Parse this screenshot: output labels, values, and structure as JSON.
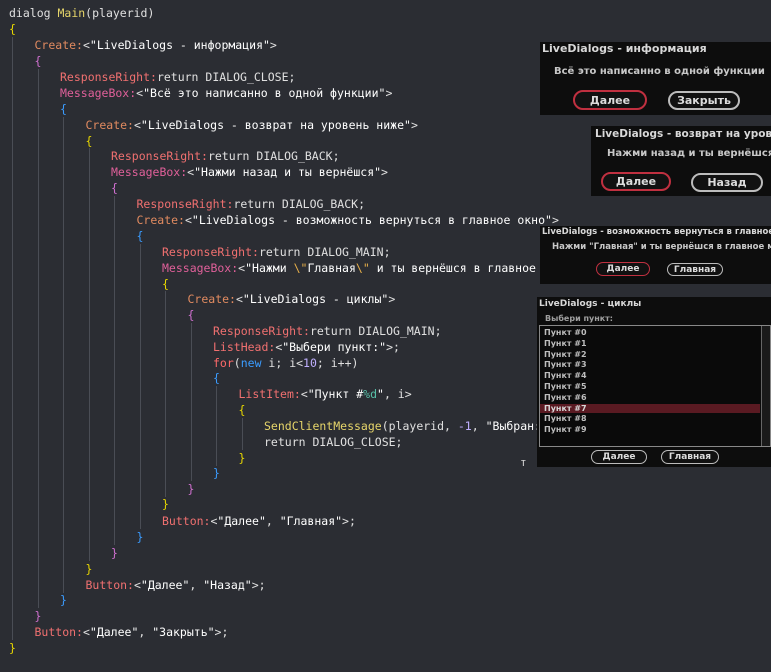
{
  "code_lines": [
    [
      [
        "dialog ",
        "op"
      ],
      [
        "Main",
        "fn"
      ],
      [
        "(playerid)",
        "op"
      ]
    ],
    [
      [
        "{",
        "b1"
      ]
    ],
    [
      [
        "Create:",
        "cr"
      ],
      [
        "<",
        "op"
      ],
      [
        "\"LiveDialogs - информация\"",
        "q"
      ],
      [
        ">",
        "op"
      ]
    ],
    [
      [
        "{",
        "b2"
      ]
    ],
    [
      [
        "ResponseRight:",
        "k"
      ],
      [
        "return ",
        "op"
      ],
      [
        "DIALOG_CLOSE;",
        "op"
      ]
    ],
    [
      [
        "MessageBox:",
        "mb"
      ],
      [
        "<",
        "op"
      ],
      [
        "\"Всё это написанно в одной функции\"",
        "q"
      ],
      [
        ">",
        "op"
      ]
    ],
    [
      [
        "{",
        "b3"
      ]
    ],
    [
      [
        "Create:",
        "cr"
      ],
      [
        "<",
        "op"
      ],
      [
        "\"LiveDialogs - возврат на уровень ниже\"",
        "q"
      ],
      [
        ">",
        "op"
      ]
    ],
    [
      [
        "{",
        "b1"
      ]
    ],
    [
      [
        "ResponseRight:",
        "k"
      ],
      [
        "return ",
        "op"
      ],
      [
        "DIALOG_BACK;",
        "op"
      ]
    ],
    [
      [
        "MessageBox:",
        "mb"
      ],
      [
        "<",
        "op"
      ],
      [
        "\"Нажми назад и ты вернёшся\"",
        "q"
      ],
      [
        ">",
        "op"
      ]
    ],
    [
      [
        "{",
        "b2"
      ]
    ],
    [
      [
        "ResponseRight:",
        "k"
      ],
      [
        "return ",
        "op"
      ],
      [
        "DIALOG_BACK;",
        "op"
      ]
    ],
    [
      [
        "Create:",
        "cr"
      ],
      [
        "<",
        "op"
      ],
      [
        "\"LiveDialogs - возможность вернуться в главное окно\"",
        "q"
      ],
      [
        ">",
        "op"
      ]
    ],
    [
      [
        "{",
        "b3"
      ]
    ],
    [
      [
        "ResponseRight:",
        "k"
      ],
      [
        "return ",
        "op"
      ],
      [
        "DIALOG_MAIN;",
        "op"
      ]
    ],
    [
      [
        "MessageBox:",
        "mb"
      ],
      [
        "<",
        "op"
      ],
      [
        "\"Нажми ",
        "q"
      ],
      [
        "\\\"",
        "esc"
      ],
      [
        "Главная",
        "q"
      ],
      [
        "\\\"",
        "esc"
      ],
      [
        " и ты вернёшся в главное меню!\"",
        "q"
      ],
      [
        ">",
        "op"
      ]
    ],
    [
      [
        "{",
        "b1"
      ]
    ],
    [
      [
        "Create:",
        "cr"
      ],
      [
        "<",
        "op"
      ],
      [
        "\"LiveDialogs - циклы\"",
        "q"
      ],
      [
        ">",
        "op"
      ]
    ],
    [
      [
        "{",
        "b2"
      ]
    ],
    [
      [
        "ResponseRight:",
        "k"
      ],
      [
        "return ",
        "op"
      ],
      [
        "DIALOG_MAIN;",
        "op"
      ]
    ],
    [
      [
        "ListHead:",
        "k"
      ],
      [
        "<",
        "op"
      ],
      [
        "\"Выбери пункт:\"",
        "q"
      ],
      [
        ">;",
        "op"
      ]
    ],
    [
      [
        "for",
        "kw"
      ],
      [
        "(",
        "op"
      ],
      [
        "new ",
        "b3"
      ],
      [
        "i; i<",
        "op"
      ],
      [
        "10",
        "num"
      ],
      [
        "; i++)",
        "op"
      ]
    ],
    [
      [
        "{",
        "b3"
      ]
    ],
    [
      [
        "ListItem:",
        "k"
      ],
      [
        "<",
        "op"
      ],
      [
        "\"Пункт #",
        "q"
      ],
      [
        "%d",
        "fmt"
      ],
      [
        "\"",
        "q"
      ],
      [
        ", i>",
        "op"
      ]
    ],
    [
      [
        "{",
        "b1"
      ]
    ],
    [
      [
        "SendClientMessage",
        "fn"
      ],
      [
        "(playerid, ",
        "op"
      ],
      [
        "-1",
        "num"
      ],
      [
        ", ",
        "op"
      ],
      [
        "\"Выбран: ",
        "q"
      ],
      [
        "%d",
        "fmt"
      ],
      [
        " пункт!\"",
        "q"
      ],
      [
        ", i);",
        "op"
      ]
    ],
    [
      [
        "return ",
        "op"
      ],
      [
        "DIALOG_CLOSE;",
        "op"
      ]
    ],
    [
      [
        "}",
        "b1"
      ]
    ],
    [
      [
        "}",
        "b3"
      ]
    ],
    [
      [
        "}",
        "b2"
      ]
    ],
    [
      [
        "}",
        "b1"
      ]
    ],
    [
      [
        "Button:",
        "k"
      ],
      [
        "<",
        "op"
      ],
      [
        "\"Далее\"",
        "q"
      ],
      [
        ", ",
        "op"
      ],
      [
        "\"Главная\"",
        "q"
      ],
      [
        ">;",
        "op"
      ]
    ],
    [
      [
        "}",
        "b3"
      ]
    ],
    [
      [
        "}",
        "b2"
      ]
    ],
    [
      [
        "}",
        "b1"
      ]
    ],
    [
      [
        "Button:",
        "k"
      ],
      [
        "<",
        "op"
      ],
      [
        "\"Далее\"",
        "q"
      ],
      [
        ", ",
        "op"
      ],
      [
        "\"Назад\"",
        "q"
      ],
      [
        ">;",
        "op"
      ]
    ],
    [
      [
        "}",
        "b3"
      ]
    ],
    [
      [
        "}",
        "b2"
      ]
    ],
    [
      [
        "Button:",
        "k"
      ],
      [
        "<",
        "op"
      ],
      [
        "\"Далее\"",
        "q"
      ],
      [
        ", ",
        "op"
      ],
      [
        "\"Закрыть\"",
        "q"
      ],
      [
        ">;",
        "op"
      ]
    ],
    [
      [
        "}",
        "b1"
      ]
    ]
  ],
  "cursor_char": "т",
  "dialogs": {
    "info": {
      "title": "LiveDialogs - информация",
      "message": "Всё это написанно в одной функции",
      "btn1": "Далее",
      "btn2": "Закрыть"
    },
    "back": {
      "title": "LiveDialogs - возврат на уровень ниже",
      "message": "Нажми назад и ты вернёшся",
      "btn1": "Далее",
      "btn2": "Назад"
    },
    "main": {
      "title": "LiveDialogs - возможность вернуться в главное окно",
      "message": "Нажми \"Главная\" и ты вернёшся в главное меню!",
      "btn1": "Далее",
      "btn2": "Главная"
    },
    "loops": {
      "title": "LiveDialogs - циклы",
      "head": "Выбери пункт:",
      "items": [
        "Пункт #0",
        "Пункт #1",
        "Пункт #2",
        "Пункт #3",
        "Пункт #4",
        "Пункт #5",
        "Пункт #6",
        "Пункт #7",
        "Пункт #8",
        "Пункт #9"
      ],
      "selected_index": 7,
      "btn1": "Далее",
      "btn2": "Главная"
    }
  }
}
